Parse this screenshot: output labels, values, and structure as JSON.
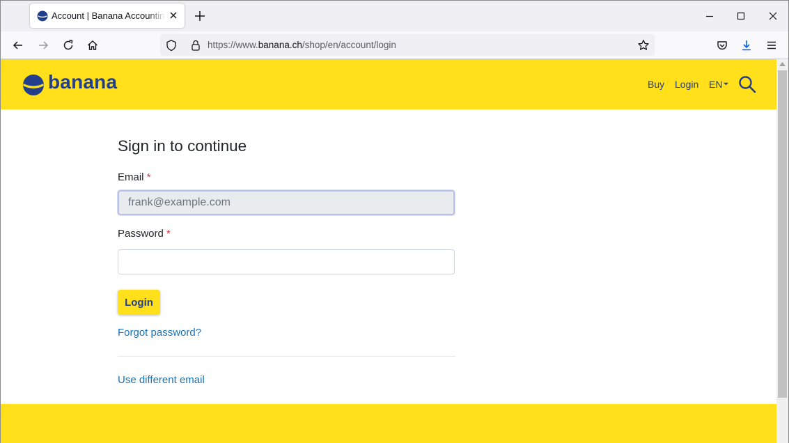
{
  "browser": {
    "tab_title": "Account | Banana Accounting S",
    "url_prefix": "https://www.",
    "url_host": "banana.ch",
    "url_path": "/shop/en/account/login"
  },
  "header": {
    "logo_text": "banana",
    "nav": {
      "buy": "Buy",
      "login": "Login",
      "language": "EN"
    }
  },
  "form": {
    "heading": "Sign in to continue",
    "email_label": "Email",
    "email_value": "frank@example.com",
    "password_label": "Password",
    "password_value": "",
    "required_mark": "*",
    "login_button": "Login",
    "forgot_link": "Forgot password?",
    "different_email_link": "Use different email"
  },
  "colors": {
    "brand_yellow": "#ffe01b",
    "brand_blue": "#233e8b",
    "link": "#1a73b8",
    "required": "#dc3545"
  },
  "icons": [
    "banana-logo-icon",
    "close-icon",
    "plus-icon",
    "minimize-icon",
    "maximize-icon",
    "window-close-icon",
    "back-icon",
    "forward-icon",
    "reload-icon",
    "home-icon",
    "shield-icon",
    "lock-icon",
    "star-icon",
    "pocket-icon",
    "download-icon",
    "menu-icon",
    "search-icon",
    "caret-down-icon"
  ]
}
